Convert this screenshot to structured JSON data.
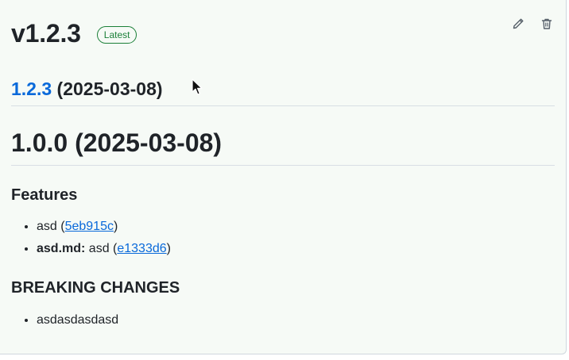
{
  "release": {
    "title": "v1.2.3",
    "badge": "Latest",
    "actions": {
      "edit_icon": "pencil-icon",
      "delete_icon": "trash-icon"
    }
  },
  "body": {
    "h2": {
      "link": "1.2.3",
      "date": "(2025-03-08)"
    },
    "h1": "1.0.0 (2025-03-08)",
    "features": {
      "heading": "Features",
      "items": [
        {
          "prefix": "asd (",
          "commit": "5eb915c",
          "suffix": ")"
        },
        {
          "bold": "asd.md:",
          "prefix": " asd (",
          "commit": "e1333d6",
          "suffix": ")"
        }
      ]
    },
    "breaking": {
      "heading": "BREAKING CHANGES",
      "items": [
        "asdasdasdasd"
      ]
    }
  },
  "colors": {
    "card_background": "#f6faf6",
    "link": "#0969da",
    "badge": "#1a7f37"
  }
}
